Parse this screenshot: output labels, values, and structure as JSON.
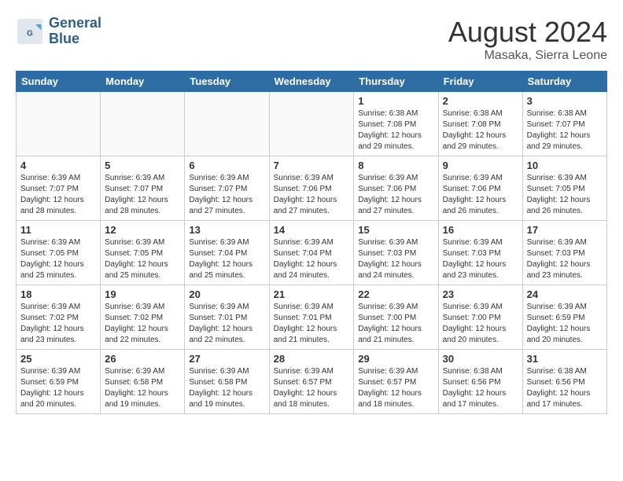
{
  "header": {
    "logo_line1": "General",
    "logo_line2": "Blue",
    "month_title": "August 2024",
    "location": "Masaka, Sierra Leone"
  },
  "weekdays": [
    "Sunday",
    "Monday",
    "Tuesday",
    "Wednesday",
    "Thursday",
    "Friday",
    "Saturday"
  ],
  "weeks": [
    [
      {
        "day": "",
        "empty": true
      },
      {
        "day": "",
        "empty": true
      },
      {
        "day": "",
        "empty": true
      },
      {
        "day": "",
        "empty": true
      },
      {
        "day": "1",
        "sunrise": "6:38 AM",
        "sunset": "7:08 PM",
        "daylight": "12 hours and 29 minutes."
      },
      {
        "day": "2",
        "sunrise": "6:38 AM",
        "sunset": "7:08 PM",
        "daylight": "12 hours and 29 minutes."
      },
      {
        "day": "3",
        "sunrise": "6:38 AM",
        "sunset": "7:07 PM",
        "daylight": "12 hours and 29 minutes."
      }
    ],
    [
      {
        "day": "4",
        "sunrise": "6:39 AM",
        "sunset": "7:07 PM",
        "daylight": "12 hours and 28 minutes."
      },
      {
        "day": "5",
        "sunrise": "6:39 AM",
        "sunset": "7:07 PM",
        "daylight": "12 hours and 28 minutes."
      },
      {
        "day": "6",
        "sunrise": "6:39 AM",
        "sunset": "7:07 PM",
        "daylight": "12 hours and 27 minutes."
      },
      {
        "day": "7",
        "sunrise": "6:39 AM",
        "sunset": "7:06 PM",
        "daylight": "12 hours and 27 minutes."
      },
      {
        "day": "8",
        "sunrise": "6:39 AM",
        "sunset": "7:06 PM",
        "daylight": "12 hours and 27 minutes."
      },
      {
        "day": "9",
        "sunrise": "6:39 AM",
        "sunset": "7:06 PM",
        "daylight": "12 hours and 26 minutes."
      },
      {
        "day": "10",
        "sunrise": "6:39 AM",
        "sunset": "7:05 PM",
        "daylight": "12 hours and 26 minutes."
      }
    ],
    [
      {
        "day": "11",
        "sunrise": "6:39 AM",
        "sunset": "7:05 PM",
        "daylight": "12 hours and 25 minutes."
      },
      {
        "day": "12",
        "sunrise": "6:39 AM",
        "sunset": "7:05 PM",
        "daylight": "12 hours and 25 minutes."
      },
      {
        "day": "13",
        "sunrise": "6:39 AM",
        "sunset": "7:04 PM",
        "daylight": "12 hours and 25 minutes."
      },
      {
        "day": "14",
        "sunrise": "6:39 AM",
        "sunset": "7:04 PM",
        "daylight": "12 hours and 24 minutes."
      },
      {
        "day": "15",
        "sunrise": "6:39 AM",
        "sunset": "7:03 PM",
        "daylight": "12 hours and 24 minutes."
      },
      {
        "day": "16",
        "sunrise": "6:39 AM",
        "sunset": "7:03 PM",
        "daylight": "12 hours and 23 minutes."
      },
      {
        "day": "17",
        "sunrise": "6:39 AM",
        "sunset": "7:03 PM",
        "daylight": "12 hours and 23 minutes."
      }
    ],
    [
      {
        "day": "18",
        "sunrise": "6:39 AM",
        "sunset": "7:02 PM",
        "daylight": "12 hours and 23 minutes."
      },
      {
        "day": "19",
        "sunrise": "6:39 AM",
        "sunset": "7:02 PM",
        "daylight": "12 hours and 22 minutes."
      },
      {
        "day": "20",
        "sunrise": "6:39 AM",
        "sunset": "7:01 PM",
        "daylight": "12 hours and 22 minutes."
      },
      {
        "day": "21",
        "sunrise": "6:39 AM",
        "sunset": "7:01 PM",
        "daylight": "12 hours and 21 minutes."
      },
      {
        "day": "22",
        "sunrise": "6:39 AM",
        "sunset": "7:00 PM",
        "daylight": "12 hours and 21 minutes."
      },
      {
        "day": "23",
        "sunrise": "6:39 AM",
        "sunset": "7:00 PM",
        "daylight": "12 hours and 20 minutes."
      },
      {
        "day": "24",
        "sunrise": "6:39 AM",
        "sunset": "6:59 PM",
        "daylight": "12 hours and 20 minutes."
      }
    ],
    [
      {
        "day": "25",
        "sunrise": "6:39 AM",
        "sunset": "6:59 PM",
        "daylight": "12 hours and 20 minutes."
      },
      {
        "day": "26",
        "sunrise": "6:39 AM",
        "sunset": "6:58 PM",
        "daylight": "12 hours and 19 minutes."
      },
      {
        "day": "27",
        "sunrise": "6:39 AM",
        "sunset": "6:58 PM",
        "daylight": "12 hours and 19 minutes."
      },
      {
        "day": "28",
        "sunrise": "6:39 AM",
        "sunset": "6:57 PM",
        "daylight": "12 hours and 18 minutes."
      },
      {
        "day": "29",
        "sunrise": "6:39 AM",
        "sunset": "6:57 PM",
        "daylight": "12 hours and 18 minutes."
      },
      {
        "day": "30",
        "sunrise": "6:38 AM",
        "sunset": "6:56 PM",
        "daylight": "12 hours and 17 minutes."
      },
      {
        "day": "31",
        "sunrise": "6:38 AM",
        "sunset": "6:56 PM",
        "daylight": "12 hours and 17 minutes."
      }
    ]
  ]
}
